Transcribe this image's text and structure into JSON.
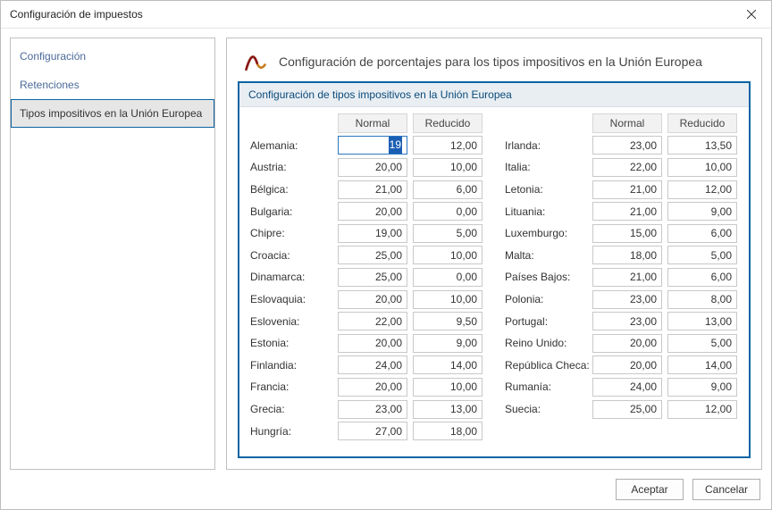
{
  "window": {
    "title": "Configuración de impuestos"
  },
  "nav": {
    "items": [
      {
        "label": "Configuración"
      },
      {
        "label": "Retenciones"
      },
      {
        "label": "Tipos impositivos en la Unión Europea"
      }
    ]
  },
  "main": {
    "heading": "Configuración de porcentajes para los tipos impositivos en la Unión Europea",
    "panel_title": "Configuración de tipos impositivos en la Unión Europea",
    "cols": {
      "normal": "Normal",
      "reducido": "Reducido"
    },
    "left": [
      {
        "country": "Alemania:",
        "normal": "19",
        "reducido": "12,00",
        "focus": true
      },
      {
        "country": "Austria:",
        "normal": "20,00",
        "reducido": "10,00"
      },
      {
        "country": "Bélgica:",
        "normal": "21,00",
        "reducido": "6,00"
      },
      {
        "country": "Bulgaria:",
        "normal": "20,00",
        "reducido": "0,00"
      },
      {
        "country": "Chipre:",
        "normal": "19,00",
        "reducido": "5,00"
      },
      {
        "country": "Croacia:",
        "normal": "25,00",
        "reducido": "10,00"
      },
      {
        "country": "Dinamarca:",
        "normal": "25,00",
        "reducido": "0,00"
      },
      {
        "country": "Eslovaquia:",
        "normal": "20,00",
        "reducido": "10,00"
      },
      {
        "country": "Eslovenia:",
        "normal": "22,00",
        "reducido": "9,50"
      },
      {
        "country": "Estonia:",
        "normal": "20,00",
        "reducido": "9,00"
      },
      {
        "country": "Finlandia:",
        "normal": "24,00",
        "reducido": "14,00"
      },
      {
        "country": "Francia:",
        "normal": "20,00",
        "reducido": "10,00"
      },
      {
        "country": "Grecia:",
        "normal": "23,00",
        "reducido": "13,00"
      },
      {
        "country": "Hungría:",
        "normal": "27,00",
        "reducido": "18,00"
      }
    ],
    "right": [
      {
        "country": "Irlanda:",
        "normal": "23,00",
        "reducido": "13,50"
      },
      {
        "country": "Italia:",
        "normal": "22,00",
        "reducido": "10,00"
      },
      {
        "country": "Letonia:",
        "normal": "21,00",
        "reducido": "12,00"
      },
      {
        "country": "Lituania:",
        "normal": "21,00",
        "reducido": "9,00"
      },
      {
        "country": "Luxemburgo:",
        "normal": "15,00",
        "reducido": "6,00"
      },
      {
        "country": "Malta:",
        "normal": "18,00",
        "reducido": "5,00"
      },
      {
        "country": "Países Bajos:",
        "normal": "21,00",
        "reducido": "6,00"
      },
      {
        "country": "Polonia:",
        "normal": "23,00",
        "reducido": "8,00"
      },
      {
        "country": "Portugal:",
        "normal": "23,00",
        "reducido": "13,00"
      },
      {
        "country": "Reino Unido:",
        "normal": "20,00",
        "reducido": "5,00"
      },
      {
        "country": "República Checa:",
        "normal": "20,00",
        "reducido": "14,00"
      },
      {
        "country": "Rumanía:",
        "normal": "24,00",
        "reducido": "9,00"
      },
      {
        "country": "Suecia:",
        "normal": "25,00",
        "reducido": "12,00"
      }
    ]
  },
  "buttons": {
    "accept": "Aceptar",
    "cancel": "Cancelar"
  }
}
